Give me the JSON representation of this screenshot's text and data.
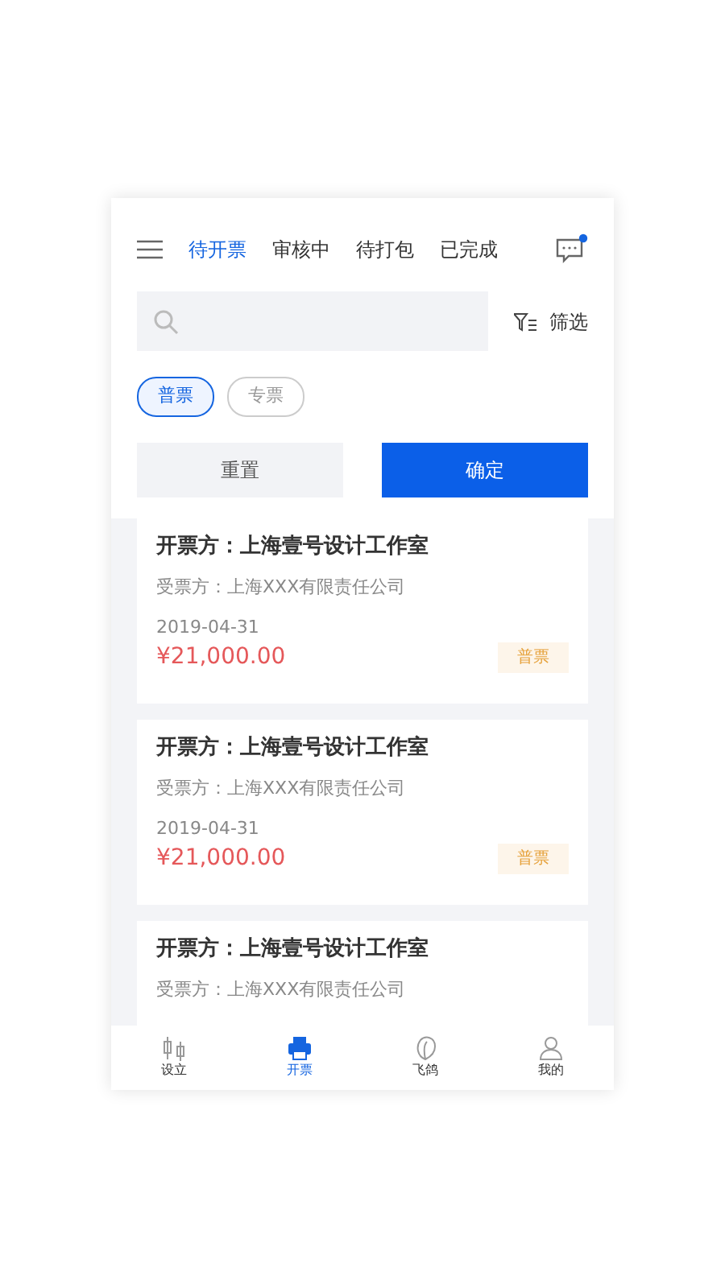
{
  "tabs": [
    {
      "label": "待开票",
      "selected": true
    },
    {
      "label": "审核中",
      "selected": false
    },
    {
      "label": "待打包",
      "selected": false
    },
    {
      "label": "已完成",
      "selected": false
    }
  ],
  "messages": {
    "unread": true
  },
  "search": {
    "filter_label": "筛选"
  },
  "chips": [
    {
      "label": "普票",
      "selected": true
    },
    {
      "label": "专票",
      "selected": false
    }
  ],
  "buttons": [
    {
      "label": "重置",
      "kind": "secondary"
    },
    {
      "label": "确定",
      "kind": "primary"
    }
  ],
  "invoices": [
    {
      "issuer": "开票方：上海壹号设计工作室",
      "receiver": "受票方：上海XXX有限责任公司",
      "date": "2019-04-31",
      "amount": "¥21,000.00",
      "tag": "普票"
    },
    {
      "issuer": "开票方：上海壹号设计工作室",
      "receiver": "受票方：上海XXX有限责任公司",
      "date": "2019-04-31",
      "amount": "¥21,000.00",
      "tag": "普票"
    },
    {
      "issuer": "开票方：上海壹号设计工作室",
      "receiver": "受票方：上海XXX有限责任公司"
    }
  ],
  "bottom_nav": [
    {
      "label": "设立",
      "selected": false
    },
    {
      "label": "开票",
      "selected": true
    },
    {
      "label": "飞鸽",
      "selected": false
    },
    {
      "label": "我的",
      "selected": false
    }
  ]
}
